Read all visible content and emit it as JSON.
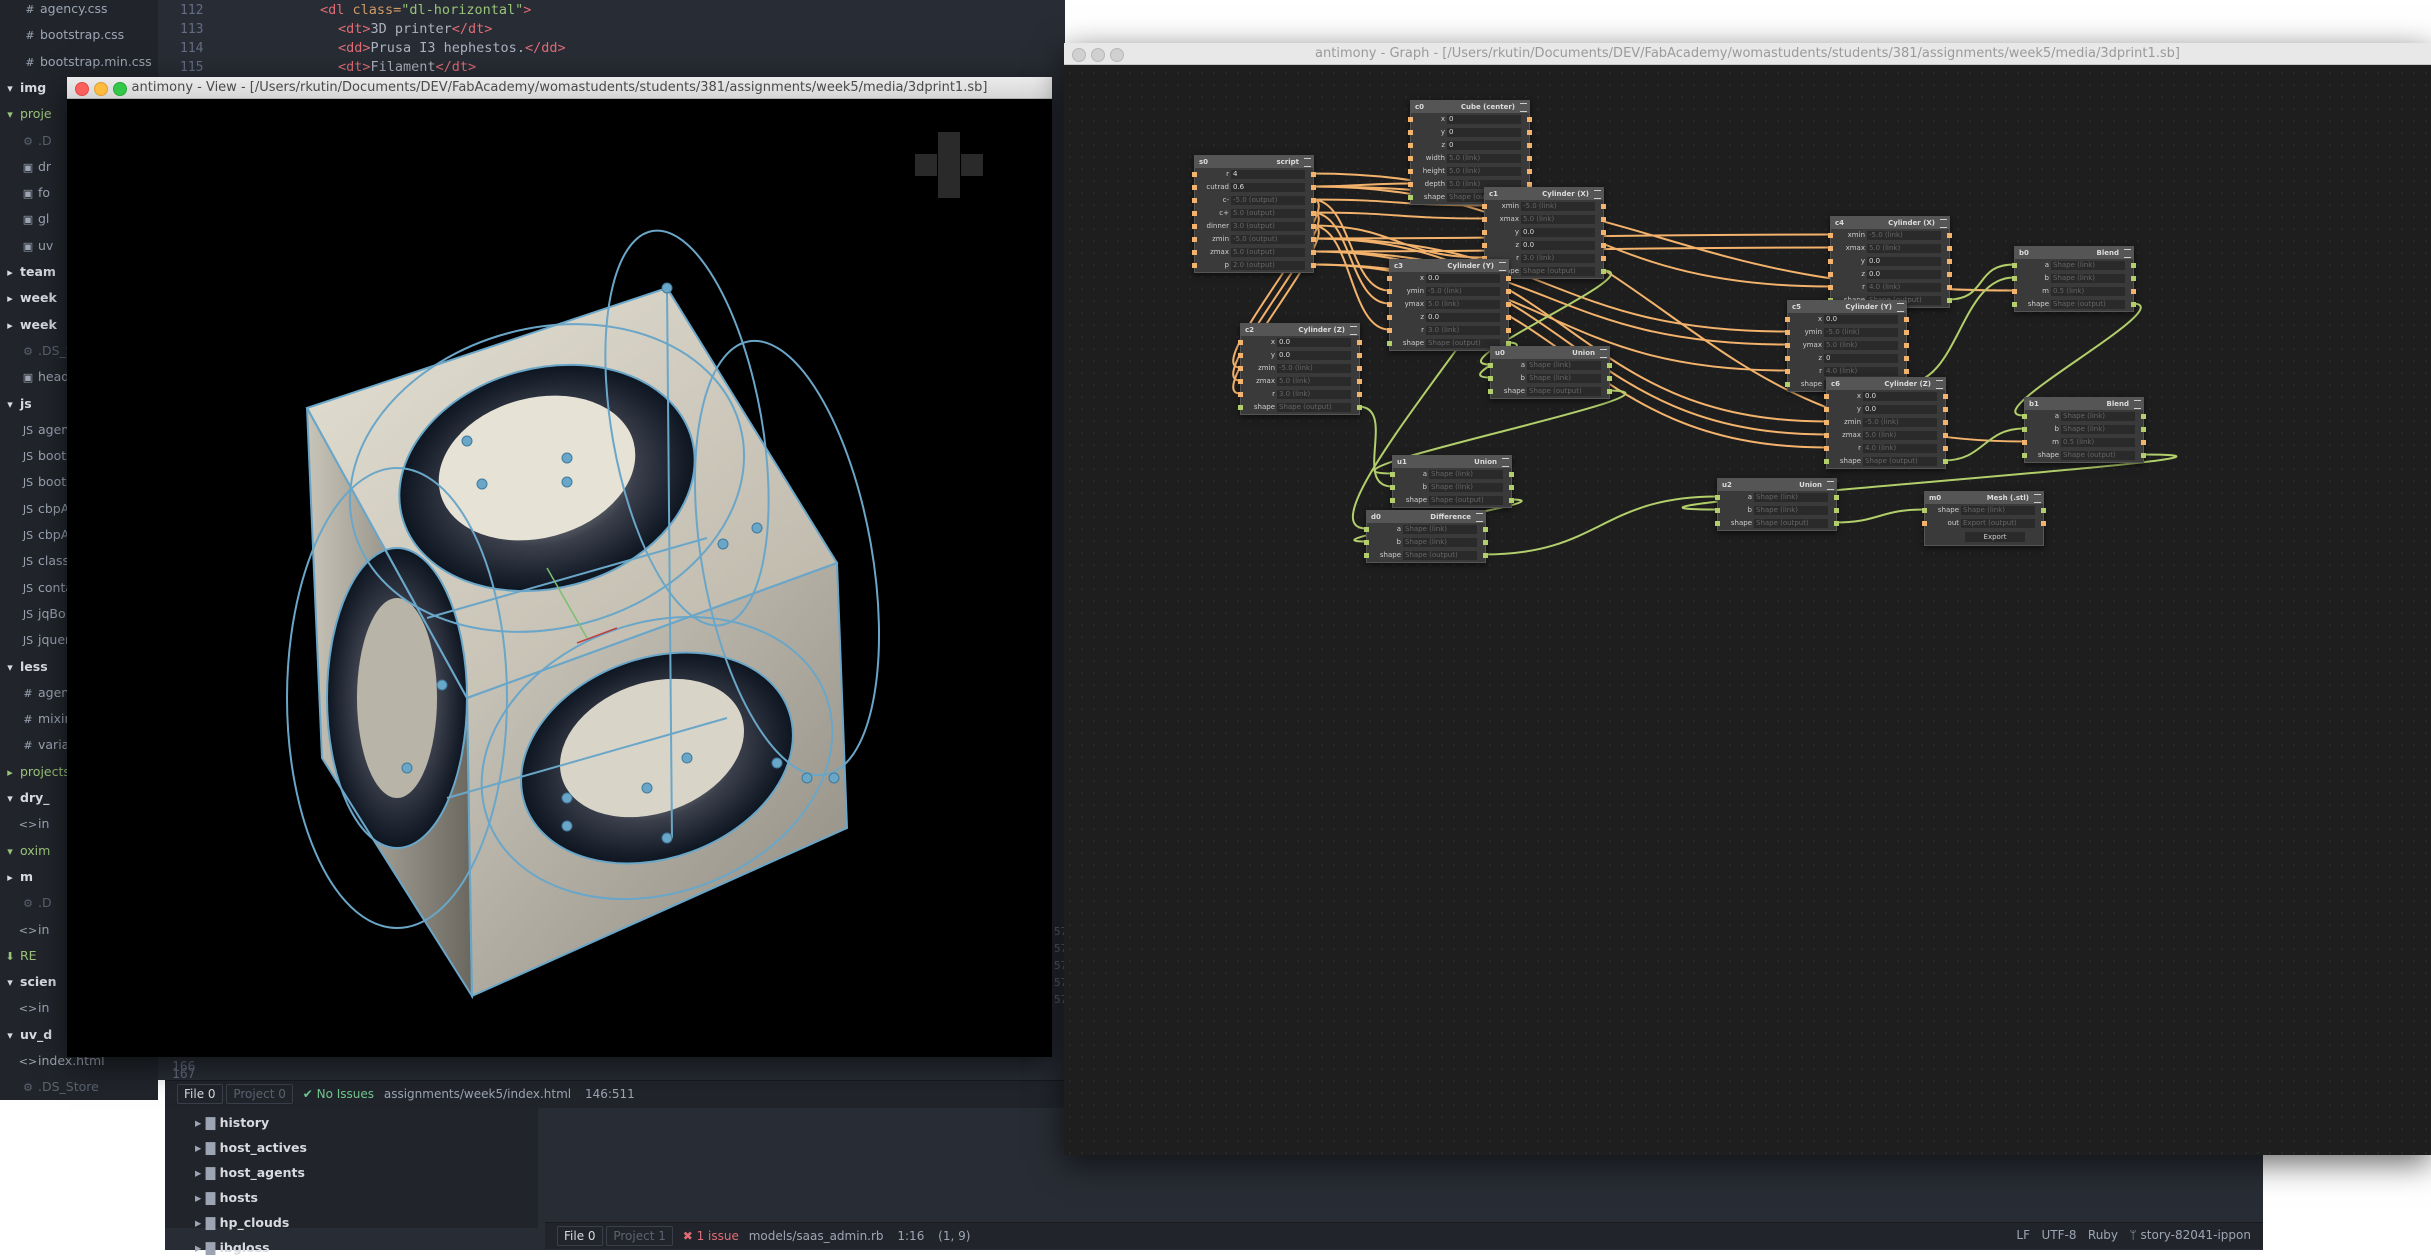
{
  "tree": {
    "items": [
      {
        "label": "agency.css",
        "icon": "#",
        "kind": "file"
      },
      {
        "label": "bootstrap.css",
        "icon": "#",
        "kind": "file"
      },
      {
        "label": "bootstrap.min.css",
        "icon": "#",
        "kind": "file"
      },
      {
        "label": "img",
        "icon": "▾",
        "kind": "dir"
      },
      {
        "label": "proje",
        "icon": "▾",
        "kind": "hl"
      },
      {
        "label": ".D",
        "icon": "⚙",
        "kind": "gray"
      },
      {
        "label": "dr",
        "icon": "▣",
        "kind": "file"
      },
      {
        "label": "fo",
        "icon": "▣",
        "kind": "file"
      },
      {
        "label": "gl",
        "icon": "▣",
        "kind": "file"
      },
      {
        "label": "uv",
        "icon": "▣",
        "kind": "file"
      },
      {
        "label": "team",
        "icon": "▸",
        "kind": "dir"
      },
      {
        "label": "week",
        "icon": "▸",
        "kind": "dir"
      },
      {
        "label": "week",
        "icon": "▸",
        "kind": "dir"
      },
      {
        "label": ".DS_S",
        "icon": "⚙",
        "kind": "gray"
      },
      {
        "label": "heade",
        "icon": "▣",
        "kind": "file"
      },
      {
        "label": "js",
        "icon": "▾",
        "kind": "dir"
      },
      {
        "label": "agen",
        "icon": "JS",
        "kind": "file"
      },
      {
        "label": "boots",
        "icon": "JS",
        "kind": "file"
      },
      {
        "label": "boots",
        "icon": "JS",
        "kind": "file"
      },
      {
        "label": "cbpA",
        "icon": "JS",
        "kind": "file"
      },
      {
        "label": "cbpA",
        "icon": "JS",
        "kind": "file"
      },
      {
        "label": "classi",
        "icon": "JS",
        "kind": "file"
      },
      {
        "label": "conta",
        "icon": "JS",
        "kind": "file"
      },
      {
        "label": "jqBo",
        "icon": "JS",
        "kind": "file"
      },
      {
        "label": "jquer",
        "icon": "JS",
        "kind": "file"
      },
      {
        "label": "less",
        "icon": "▾",
        "kind": "dir"
      },
      {
        "label": "agen",
        "icon": "#",
        "kind": "file"
      },
      {
        "label": "mixin",
        "icon": "#",
        "kind": "file"
      },
      {
        "label": "varia",
        "icon": "#",
        "kind": "file"
      },
      {
        "label": "projects",
        "icon": "▸",
        "kind": "hl"
      },
      {
        "label": "dry_",
        "icon": "▾",
        "kind": "dir"
      },
      {
        "label": "in",
        "icon": "<>",
        "kind": "file"
      },
      {
        "label": "oxim",
        "icon": "▾",
        "kind": "hl"
      },
      {
        "label": "m",
        "icon": "▸",
        "kind": "dir"
      },
      {
        "label": ".D",
        "icon": "⚙",
        "kind": "gray"
      },
      {
        "label": "in",
        "icon": "<>",
        "kind": "file"
      },
      {
        "label": "RE",
        "icon": "⬇",
        "kind": "hl"
      },
      {
        "label": "scien",
        "icon": "▾",
        "kind": "dir"
      },
      {
        "label": "in",
        "icon": "<>",
        "kind": "file"
      },
      {
        "label": "uv_d",
        "icon": "▾",
        "kind": "dir"
      },
      {
        "label": "index.html",
        "icon": "<>",
        "kind": "file"
      },
      {
        "label": ".DS_Store",
        "icon": "⚙",
        "kind": "gray"
      }
    ]
  },
  "code": {
    "lines": [
      {
        "num": "112",
        "tag": "<dl",
        "attr": " class=",
        "str": "\"dl-horizontal\"",
        "end": ">",
        "text": ""
      },
      {
        "num": "113",
        "tag": "<dt>",
        "attr": "",
        "str": "",
        "end": "",
        "text": "3D printer",
        "close": "</dt>"
      },
      {
        "num": "114",
        "tag": "<dd>",
        "attr": "",
        "str": "",
        "end": "",
        "text": "Prusa I3 hephestos.",
        "close": "</dd>"
      },
      {
        "num": "115",
        "tag": "<dt>",
        "attr": "",
        "str": "",
        "end": "",
        "text": "Filament",
        "close": "</dt>"
      }
    ],
    "bottom_numbers": [
      "166",
      "167"
    ],
    "partial_numbers": [
      "57",
      "57",
      "57",
      "57",
      "57"
    ]
  },
  "status1": {
    "file_badge": "File 0",
    "project_badge": "Project 0",
    "issues": "No Issues",
    "path": "assignments/week5/index.html",
    "cursor": "146:511"
  },
  "tree2": {
    "items": [
      "history",
      "host_actives",
      "host_agents",
      "hosts",
      "hp_clouds",
      "ibgloss"
    ]
  },
  "status2": {
    "file_badge": "File 0",
    "project_badge": "Project 1",
    "issues": "1 issue",
    "path": "models/saas_admin.rb",
    "cursor": "1:16",
    "selection": "(1, 9)",
    "line_ending": "LF",
    "encoding": "UTF-8",
    "grammar": "Ruby",
    "branch": "story-82041-ippon"
  },
  "view_window": {
    "title": "antimony - View - [/Users/rkutin/Documents/DEV/FabAcademy/womastudents/students/381/assignments/week5/media/3dprint1.sb]"
  },
  "graph_window": {
    "title": "antimony - Graph - [/Users/rkutin/Documents/DEV/FabAcademy/womastudents/students/381/assignments/week5/media/3dprint1.sb]"
  },
  "nodes": {
    "cube": {
      "id": "c0",
      "type": "Cube (center)",
      "rows": [
        [
          "x",
          "0"
        ],
        [
          "y",
          "0"
        ],
        [
          "z",
          "0"
        ],
        [
          "width",
          "5.0 (link)"
        ],
        [
          "height",
          "5.0 (link)"
        ],
        [
          "depth",
          "5.0 (link)"
        ],
        [
          "shape",
          "Shape (output)"
        ]
      ]
    },
    "script": {
      "id": "s0",
      "type": "script",
      "rows": [
        [
          "r",
          "4"
        ],
        [
          "cutrad",
          "0.6"
        ],
        [
          "c-",
          "-5.0 (output)"
        ],
        [
          "c+",
          "5.0 (output)"
        ],
        [
          "dinner",
          "3.0 (output)"
        ],
        [
          "zmin",
          "-5.0 (output)"
        ],
        [
          "zmax",
          "5.0 (output)"
        ],
        [
          "p",
          "2.0 (output)"
        ]
      ]
    },
    "cyl_x1": {
      "id": "c1",
      "type": "Cylinder (X)",
      "rows": [
        [
          "xmin",
          "-5.0 (link)"
        ],
        [
          "xmax",
          "5.0 (link)"
        ],
        [
          "y",
          "0.0"
        ],
        [
          "z",
          "0.0"
        ],
        [
          "r",
          "3.0 (link)"
        ],
        [
          "shape",
          "Shape (output)"
        ]
      ]
    },
    "cyl_x2": {
      "id": "c4",
      "type": "Cylinder (X)",
      "rows": [
        [
          "xmin",
          "-5.0 (link)"
        ],
        [
          "xmax",
          "5.0 (link)"
        ],
        [
          "y",
          "0.0"
        ],
        [
          "z",
          "0.0"
        ],
        [
          "r",
          "4.0 (link)"
        ],
        [
          "shape",
          "Shape (output)"
        ]
      ]
    },
    "cyl_y1": {
      "id": "c3",
      "type": "Cylinder (Y)",
      "rows": [
        [
          "x",
          "0.0"
        ],
        [
          "ymin",
          "-5.0 (link)"
        ],
        [
          "ymax",
          "5.0 (link)"
        ],
        [
          "z",
          "0.0"
        ],
        [
          "r",
          "3.0 (link)"
        ],
        [
          "shape",
          "Shape (output)"
        ]
      ]
    },
    "cyl_y2": {
      "id": "c5",
      "type": "Cylinder (Y)",
      "rows": [
        [
          "x",
          "0.0"
        ],
        [
          "ymin",
          "-5.0 (link)"
        ],
        [
          "ymax",
          "5.0 (link)"
        ],
        [
          "z",
          "0"
        ],
        [
          "r",
          "4.0 (link)"
        ],
        [
          "shape",
          "Shape (output)"
        ]
      ]
    },
    "cyl_z1": {
      "id": "c2",
      "type": "Cylinder (Z)",
      "rows": [
        [
          "x",
          "0.0"
        ],
        [
          "y",
          "0.0"
        ],
        [
          "zmin",
          "-5.0 (link)"
        ],
        [
          "zmax",
          "5.0 (link)"
        ],
        [
          "r",
          "3.0 (link)"
        ],
        [
          "shape",
          "Shape (output)"
        ]
      ]
    },
    "cyl_z2": {
      "id": "c6",
      "type": "Cylinder (Z)",
      "rows": [
        [
          "x",
          "0.0"
        ],
        [
          "y",
          "0.0"
        ],
        [
          "zmin",
          "-5.0 (link)"
        ],
        [
          "zmax",
          "5.0 (link)"
        ],
        [
          "r",
          "4.0 (link)"
        ],
        [
          "shape",
          "Shape (output)"
        ]
      ]
    },
    "union0": {
      "id": "u0",
      "type": "Union",
      "rows": [
        [
          "a",
          "Shape (link)"
        ],
        [
          "b",
          "Shape (link)"
        ],
        [
          "shape",
          "Shape (output)"
        ]
      ]
    },
    "union1": {
      "id": "u1",
      "type": "Union",
      "rows": [
        [
          "a",
          "Shape (link)"
        ],
        [
          "b",
          "Shape (link)"
        ],
        [
          "shape",
          "Shape (output)"
        ]
      ]
    },
    "union2": {
      "id": "u2",
      "type": "Union",
      "rows": [
        [
          "a",
          "Shape (link)"
        ],
        [
          "b",
          "Shape (link)"
        ],
        [
          "shape",
          "Shape (output)"
        ]
      ]
    },
    "diff": {
      "id": "d0",
      "type": "Difference",
      "rows": [
        [
          "a",
          "Shape (link)"
        ],
        [
          "b",
          "Shape (link)"
        ],
        [
          "shape",
          "Shape (output)"
        ]
      ]
    },
    "blend0": {
      "id": "b0",
      "type": "Blend",
      "rows": [
        [
          "a",
          "Shape (link)"
        ],
        [
          "b",
          "Shape (link)"
        ],
        [
          "m",
          "0.5 (link)"
        ],
        [
          "shape",
          "Shape (output)"
        ]
      ]
    },
    "blend1": {
      "id": "b1",
      "type": "Blend",
      "rows": [
        [
          "a",
          "Shape (link)"
        ],
        [
          "b",
          "Shape (link)"
        ],
        [
          "m",
          "0.5 (link)"
        ],
        [
          "shape",
          "Shape (output)"
        ]
      ]
    },
    "mesh": {
      "id": "m0",
      "type": "Mesh (.stl)",
      "rows": [
        [
          "shape",
          "Shape (link)"
        ],
        [
          "out",
          "Export (output)"
        ]
      ],
      "button": "Export"
    }
  }
}
